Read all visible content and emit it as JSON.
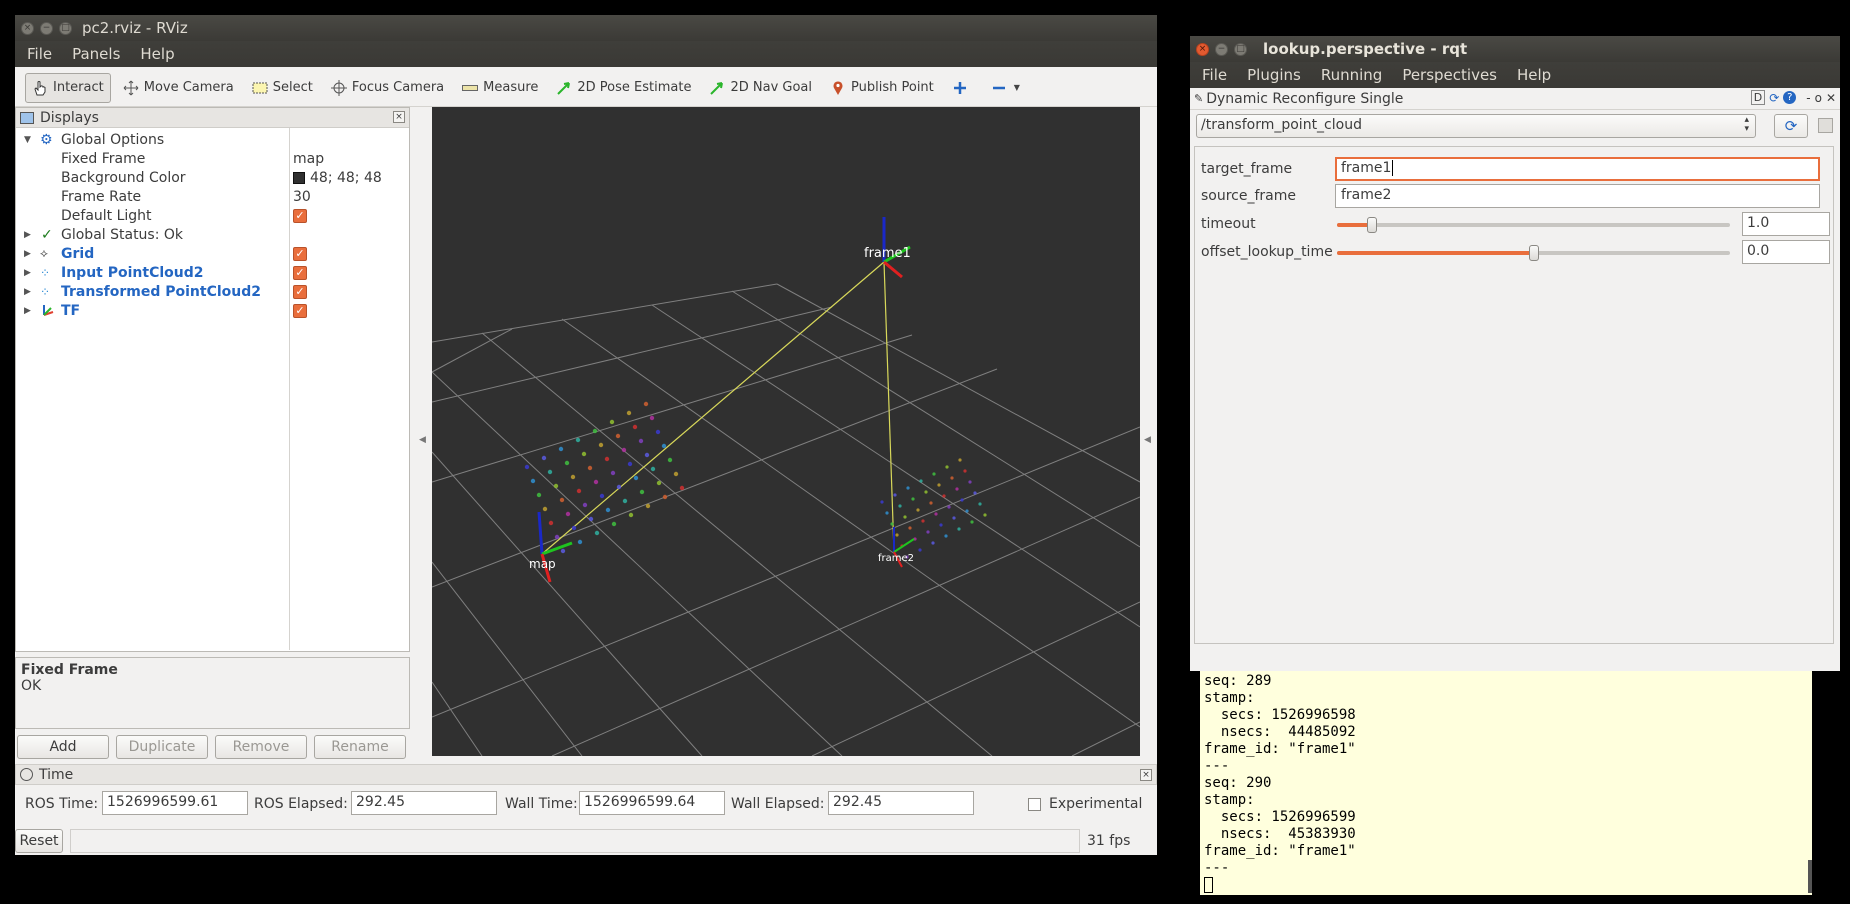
{
  "rviz": {
    "title": "pc2.rviz - RViz",
    "menu": [
      "File",
      "Panels",
      "Help"
    ],
    "toolbar": {
      "interact": "Interact",
      "move_camera": "Move Camera",
      "select": "Select",
      "focus_camera": "Focus Camera",
      "measure": "Measure",
      "pose_estimate": "2D Pose Estimate",
      "nav_goal": "2D Nav Goal",
      "publish_point": "Publish Point"
    },
    "displays": {
      "title": "Displays",
      "global_options": "Global Options",
      "fixed_frame_label": "Fixed Frame",
      "fixed_frame_value": "map",
      "bg_color_label": "Background Color",
      "bg_color_value": "48; 48; 48",
      "frame_rate_label": "Frame Rate",
      "frame_rate_value": "30",
      "default_light_label": "Default Light",
      "global_status": "Global Status: Ok",
      "grid": "Grid",
      "input_pc": "Input PointCloud2",
      "transformed_pc": "Transformed PointCloud2",
      "tf": "TF"
    },
    "description": {
      "title": "Fixed Frame",
      "text": "OK"
    },
    "buttons": {
      "add": "Add",
      "duplicate": "Duplicate",
      "remove": "Remove",
      "rename": "Rename"
    },
    "viewport": {
      "frame_labels": {
        "frame1": "frame1",
        "map": "map",
        "frame2": "frame2"
      }
    },
    "time": {
      "title": "Time",
      "ros_time_label": "ROS Time:",
      "ros_time_value": "1526996599.61",
      "ros_elapsed_label": "ROS Elapsed:",
      "ros_elapsed_value": "292.45",
      "wall_time_label": "Wall Time:",
      "wall_time_value": "1526996599.64",
      "wall_elapsed_label": "Wall Elapsed:",
      "wall_elapsed_value": "292.45",
      "experimental_label": "Experimental",
      "reset": "Reset",
      "fps": "31 fps"
    }
  },
  "rqt": {
    "title": "lookup.perspective - rqt",
    "menu": [
      "File",
      "Plugins",
      "Running",
      "Perspectives",
      "Help"
    ],
    "plugin_title": "Dynamic Reconfigure Single",
    "plugin_tools": "D",
    "node": "/transform_point_cloud",
    "params": {
      "target_frame": {
        "label": "target_frame",
        "value": "frame1"
      },
      "source_frame": {
        "label": "source_frame",
        "value": "frame2"
      },
      "timeout": {
        "label": "timeout",
        "value": "1.0",
        "fraction": 0.09
      },
      "offset_lookup_time": {
        "label": "offset_lookup_time",
        "value": "0.0",
        "fraction": 0.5
      }
    }
  },
  "terminal": {
    "text": "seq: 289\nstamp:\n  secs: 1526996598\n  nsecs:  44485092\nframe_id: \"frame1\"\n---\nseq: 290\nstamp:\n  secs: 1526996599\n  nsecs:  45383930\nframe_id: \"frame1\"\n---"
  },
  "colors": {
    "accent": "#e96e3c",
    "link_blue": "#2466c2",
    "viewport_bg": "#303030",
    "terminal_bg": "#ffffdd"
  }
}
